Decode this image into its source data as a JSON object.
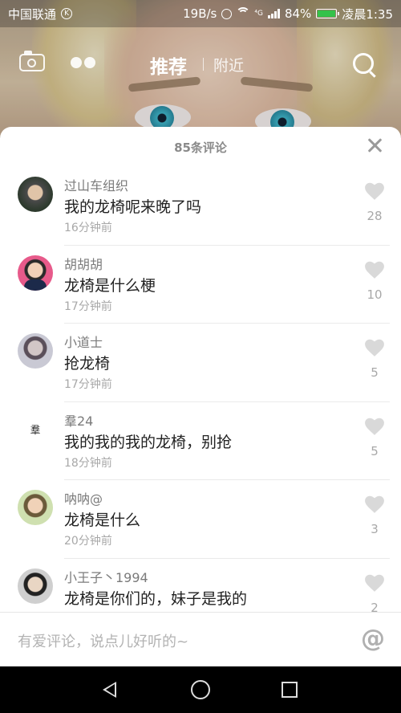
{
  "status_bar": {
    "carrier": "中国联通",
    "speed": "19B/s",
    "network_badge": "⁴G",
    "battery": "84%",
    "time": "凌晨1:35"
  },
  "top_nav": {
    "tab_recommend": "推荐",
    "tab_nearby": "附近",
    "icons": [
      "camera-icon",
      "dots-icon",
      "search-icon"
    ]
  },
  "comments_panel": {
    "title": "85条评论",
    "comments": [
      {
        "user": "过山车组织",
        "text": "我的龙椅呢来晚了吗",
        "time": "16分钟前",
        "likes": "28"
      },
      {
        "user": "胡胡胡",
        "text": "龙椅是什么梗",
        "time": "17分钟前",
        "likes": "10"
      },
      {
        "user": "小道士",
        "text": "抢龙椅",
        "time": "17分钟前",
        "likes": "5"
      },
      {
        "user": "羣24",
        "text": "我的我的我的龙椅，别抢",
        "time": "18分钟前",
        "likes": "5",
        "avatar_text": "羣"
      },
      {
        "user": "呐呐@",
        "text": "龙椅是什么",
        "time": "20分钟前",
        "likes": "3"
      },
      {
        "user": "小王子丶1994",
        "text": "龙椅是你们的，妹子是我的",
        "time": "",
        "likes": "2"
      }
    ],
    "input_placeholder": "有爱评论，说点儿好听的~",
    "at_symbol": "@"
  },
  "colors": {
    "sheet_bg": "#ffffff",
    "text_primary": "#222222",
    "text_secondary": "#a8a8a8",
    "heart": "#d9d9d9"
  }
}
